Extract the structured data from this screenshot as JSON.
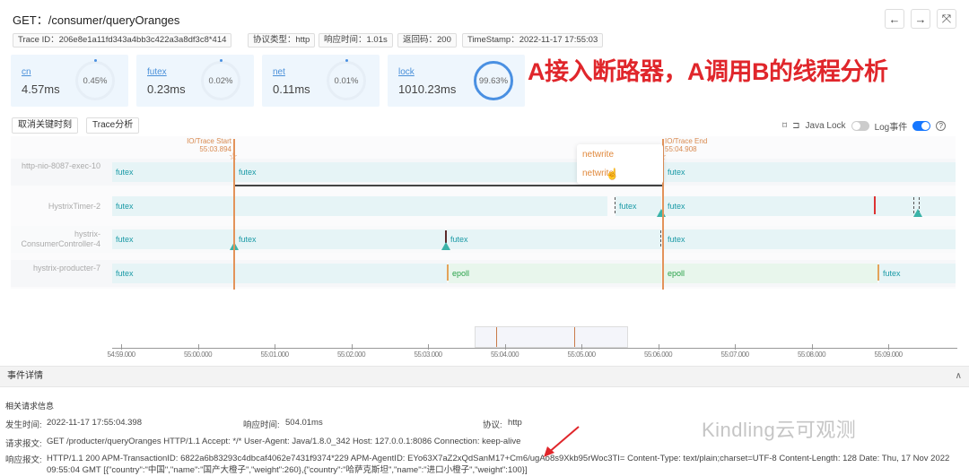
{
  "header": {
    "title": "GET：/consumer/queryOranges",
    "nav": {
      "back": "←",
      "forward": "→",
      "fullscreen": "⤧"
    }
  },
  "tags": [
    "Trace ID：206e8e1a11fd343a4bb3c422a3a8df3c8*414",
    "协议类型：http",
    "响应时间：1.01s",
    "返回码：200",
    "TimeStamp：2022-11-17 17:55:03"
  ],
  "cards": [
    {
      "name": "cn",
      "value": "4.57ms",
      "percent": "0.45%"
    },
    {
      "name": "futex",
      "value": "0.23ms",
      "percent": "0.02%"
    },
    {
      "name": "net",
      "value": "0.11ms",
      "percent": "0.01%"
    },
    {
      "name": "lock",
      "value": "1010.23ms",
      "percent": "99.63%"
    }
  ],
  "annotation": "A接入断路器，A调用B的线程分析",
  "buttons": {
    "cancel_key": "取消关键时刻",
    "trace_analysis": "Trace分析"
  },
  "toolbar": {
    "java_lock": "Java Lock",
    "java_lock_on": false,
    "log_events": "Log事件",
    "log_events_on": true,
    "help": "?"
  },
  "markers": {
    "start_label": "IO/Trace Start",
    "start_time": "55:03.894",
    "end_label": "IO/Trace End",
    "end_time": "55:04.908"
  },
  "threads": [
    {
      "name": "http-nio-8087-exec-10",
      "segments": [
        "futex",
        "futex",
        "futex"
      ]
    },
    {
      "name": "HystrixTimer-2",
      "segments": [
        "futex",
        "futex",
        "futex"
      ]
    },
    {
      "name": "hystrix-ConsumerController-4",
      "segments": [
        "futex",
        "futex",
        "futex",
        "futex"
      ]
    },
    {
      "name": "hystrix-producter-7",
      "segments": [
        "futex",
        "epoll",
        "epoll",
        "futex"
      ]
    }
  ],
  "popup": [
    "netwrite",
    "netwrite"
  ],
  "axis_ticks": [
    "54:59.000",
    "55:00.000",
    "55:01.000",
    "55:02.000",
    "55:03.000",
    "55:04.000",
    "55:05.000",
    "55:06.000",
    "55:07.000",
    "55:08.000",
    "55:09.000"
  ],
  "details": {
    "section_title": "事件详情",
    "subtitle": "相关请求信息",
    "time_label": "发生时间:",
    "time": "2022-11-17 17:55:04.398",
    "resp_time_label": "响应时间:",
    "resp_time": "504.01ms",
    "protocol_label": "协议:",
    "protocol": "http",
    "request_label": "请求报文:",
    "request": "GET /producter/queryOranges HTTP/1.1 Accept: */* User-Agent: Java/1.8.0_342 Host: 127.0.0.1:8086 Connection: keep-alive",
    "response_label": "响应报文:",
    "response": "HTTP/1.1 200 APM-TransactionID: 6822a6b83293c4dbcaf4062e7431f9374*229 APM-AgentID: EYo63X7aZ2xQdSanM17+Cm6/ugAo8s9Xkb95rWoc3TI= Content-Type: text/plain;charset=UTF-8 Content-Length: 128 Date: Thu, 17 Nov 2022 09:55:04 GMT [{\"country\":\"中国\",\"name\":\"国产大橙子\",\"weight\":260},{\"country\":\"哈萨克斯坦\",\"name\":\"进口小橙子\",\"weight\":100}]"
  },
  "watermark": "Kindling云可观测"
}
